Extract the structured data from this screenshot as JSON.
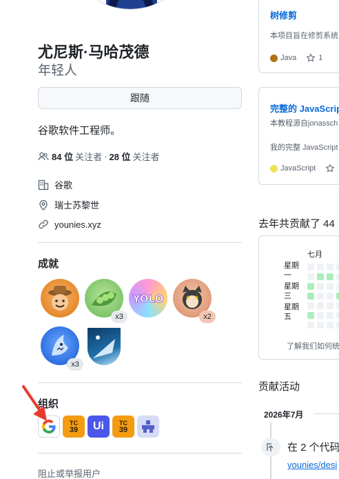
{
  "profile": {
    "name": "尤尼斯·马哈茂德",
    "login": "年轻人",
    "follow_label": "跟随",
    "bio": "谷歌软件工程师。",
    "followers_count": "84 位",
    "followers_label": "关注者",
    "separator": "·",
    "following_count": "28 位",
    "following_label": "关注者",
    "company": "谷歌",
    "location": "瑞士苏黎世",
    "website": "younies.xyz"
  },
  "achievements": {
    "title": "成就",
    "badges": [
      {
        "icon": "cowboy-badge-icon",
        "count": ""
      },
      {
        "icon": "peas-badge-icon",
        "count": "x3"
      },
      {
        "icon": "yolo-badge-icon",
        "count": ""
      },
      {
        "icon": "cat-badge-icon",
        "count": "x2"
      },
      {
        "icon": "shark-badge-icon",
        "count": "x3"
      },
      {
        "icon": "arctic-code-vault-icon",
        "count": ""
      }
    ]
  },
  "organizations": {
    "title": "组织",
    "items": [
      {
        "icon": "google-org-icon",
        "label": "G"
      },
      {
        "icon": "tc39-org-icon",
        "label": "TC 39"
      },
      {
        "icon": "unicode-org-icon",
        "label": "Ui"
      },
      {
        "icon": "tc39-org-icon",
        "label": "TC 39"
      },
      {
        "icon": "puzzle-org-icon",
        "label": ""
      }
    ]
  },
  "report_link": "阻止或举报用户",
  "pinned": [
    {
      "title": "树修剪",
      "desc": "本项目旨在修剪系统",
      "lang": "Java",
      "lang_color": "#b07219",
      "stars": "1"
    },
    {
      "title": "完整的 JavaScript",
      "desc": "本教程源自jonassch",
      "desc2": "我的完整 JavaScript",
      "lang": "JavaScript",
      "lang_color": "#f1e05a"
    }
  ],
  "contributions": {
    "title": "去年共贡献了 44",
    "month": "七月",
    "days": [
      "星期一",
      "星期三",
      "星期五"
    ],
    "learn_more": "了解我们如何统"
  },
  "activity": {
    "title": "贡献活动",
    "month": "2026年7月",
    "item_text": "在 2 个代码",
    "item_link": "younies/desi"
  },
  "colors": {
    "accent": "#0969da",
    "muted": "#59636e",
    "border": "#d1d9e0",
    "arrow": "#e8392e"
  }
}
